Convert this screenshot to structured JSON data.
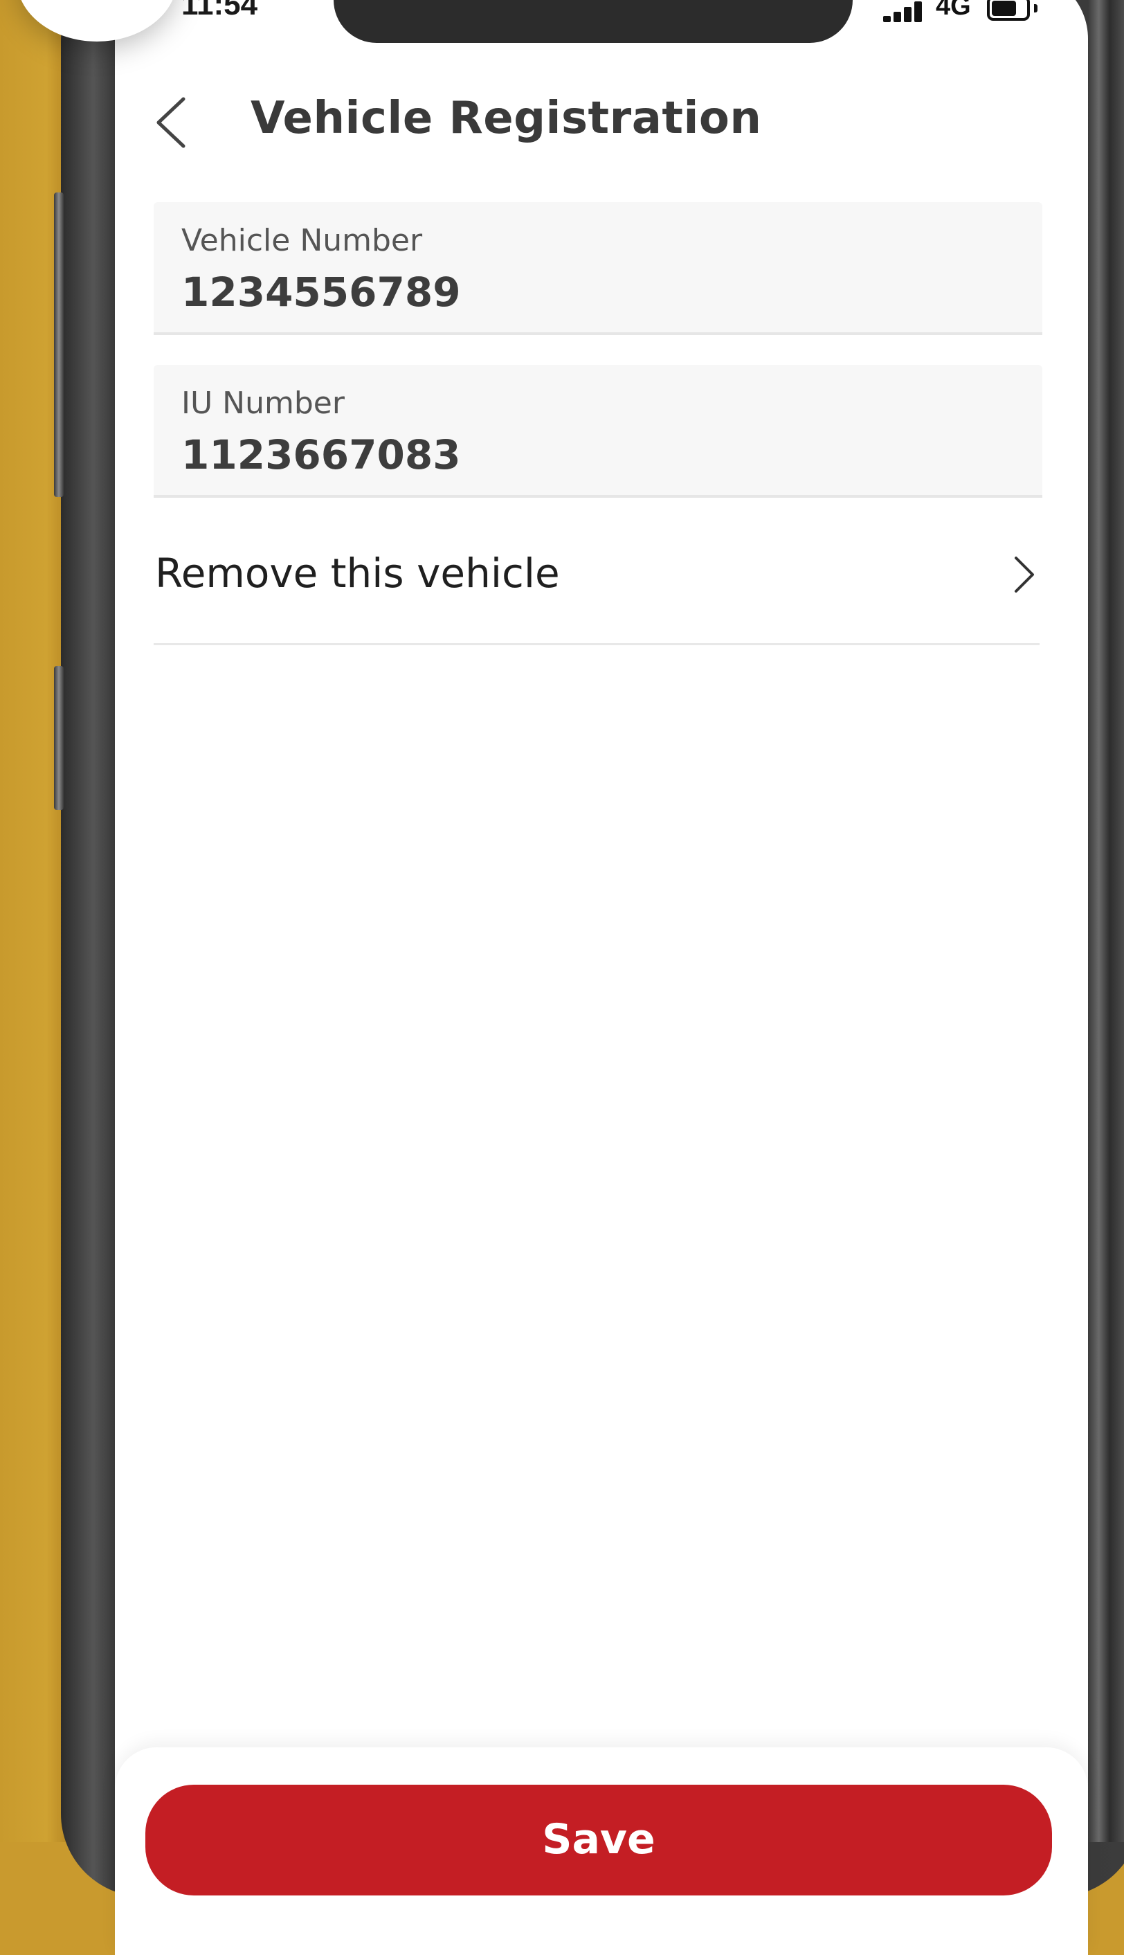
{
  "status_bar": {
    "time": "11:54",
    "network": "4G",
    "battery_level": 0.64
  },
  "header": {
    "title": "Vehicle Registration",
    "back_icon": "chevron-left-icon"
  },
  "form": {
    "vehicle_number": {
      "label": "Vehicle Number",
      "value": "1234556789"
    },
    "iu_number": {
      "label": "IU Number",
      "value": "1123667083"
    }
  },
  "actions": {
    "remove_label": "Remove this vehicle",
    "remove_icon": "chevron-right-icon",
    "save_label": "Save"
  },
  "colors": {
    "accent": "#c41e24",
    "background": "#c99a2e",
    "field_bg": "#f7f7f7",
    "title_text": "#3a3a3a"
  }
}
